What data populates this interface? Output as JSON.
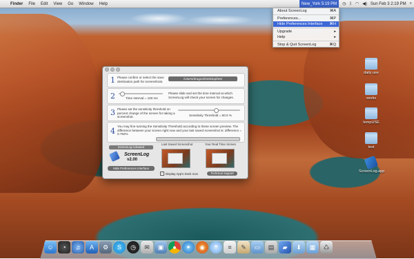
{
  "menubar": {
    "apple": "",
    "app_name": "Finder",
    "menus": [
      "File",
      "Edit",
      "View",
      "Go",
      "Window",
      "Help"
    ],
    "status_app": "New_York 5:19 PM",
    "clock": "Sun Feb 3  2:19 PM"
  },
  "dropdown": {
    "items": [
      {
        "label": "About ScreenLog",
        "shortcut": "⌘A"
      },
      {
        "label": "Preferences...",
        "shortcut": "⌘P"
      },
      {
        "label": "Hide Preferences Interface",
        "shortcut": "⌘H"
      },
      {
        "label": "Upgrade",
        "shortcut": "▸"
      },
      {
        "label": "Help",
        "shortcut": "▸"
      },
      {
        "label": "Stop & Quit ScreenLog",
        "shortcut": "⌘Q"
      }
    ]
  },
  "desktop_icons": [
    {
      "label": "daily use"
    },
    {
      "label": "works"
    },
    {
      "label": "tempUSE"
    },
    {
      "label": "test"
    },
    {
      "label": "ScreenLog.app"
    }
  ],
  "pref": {
    "step1_num": "1",
    "step1_text": "Please confirm or select the save destination path for screenshots.",
    "step1_path": "/Users/dragon/Desktop/test",
    "step2_num": "2",
    "step2_label": "Time Interval = 100 ms",
    "step2_text": "Please slide and set the time interval at which ScreenLog will check your screen for changes.",
    "step3_num": "3",
    "step3_text": "Please set the sensitivity threshold on percent change of the screen for taking a screenshot.",
    "step3_label": "Sensitivity Threshold = 60.0 %",
    "step4_num": "4",
    "step4_text": "You may fine tunning the Sensitivity Threshold according to these screen preview. The difference between your screen right now and your last saved screenshot is: difference = 0.792%",
    "activated": "ScreenLog Activated",
    "app_name": "ScreenLog",
    "version": "v2.00",
    "hide_button": "Hide Preferences Interface",
    "last_saved_label": "Last Saved Screenshot",
    "real_time_label": "Your Real Time Screen",
    "dock_icon_label": "Display App's Dock Icon",
    "dock_icon_checked": "✓",
    "support_button": "Technical Support"
  },
  "dock": {
    "icons": [
      "finder-icon",
      "dashboard-icon",
      "itunes-icon",
      "app-store-icon",
      "skype-icon",
      "time-machine-icon",
      "mail-icon",
      "photo-icon",
      "chrome-icon",
      "safari-icon",
      "firefox-icon",
      "messages-icon",
      "notes-icon",
      "preview-icon",
      "folder-icon",
      "document-icon",
      "screenlog-icon",
      "downloads-icon",
      "stack-icon",
      "trash-icon"
    ]
  }
}
